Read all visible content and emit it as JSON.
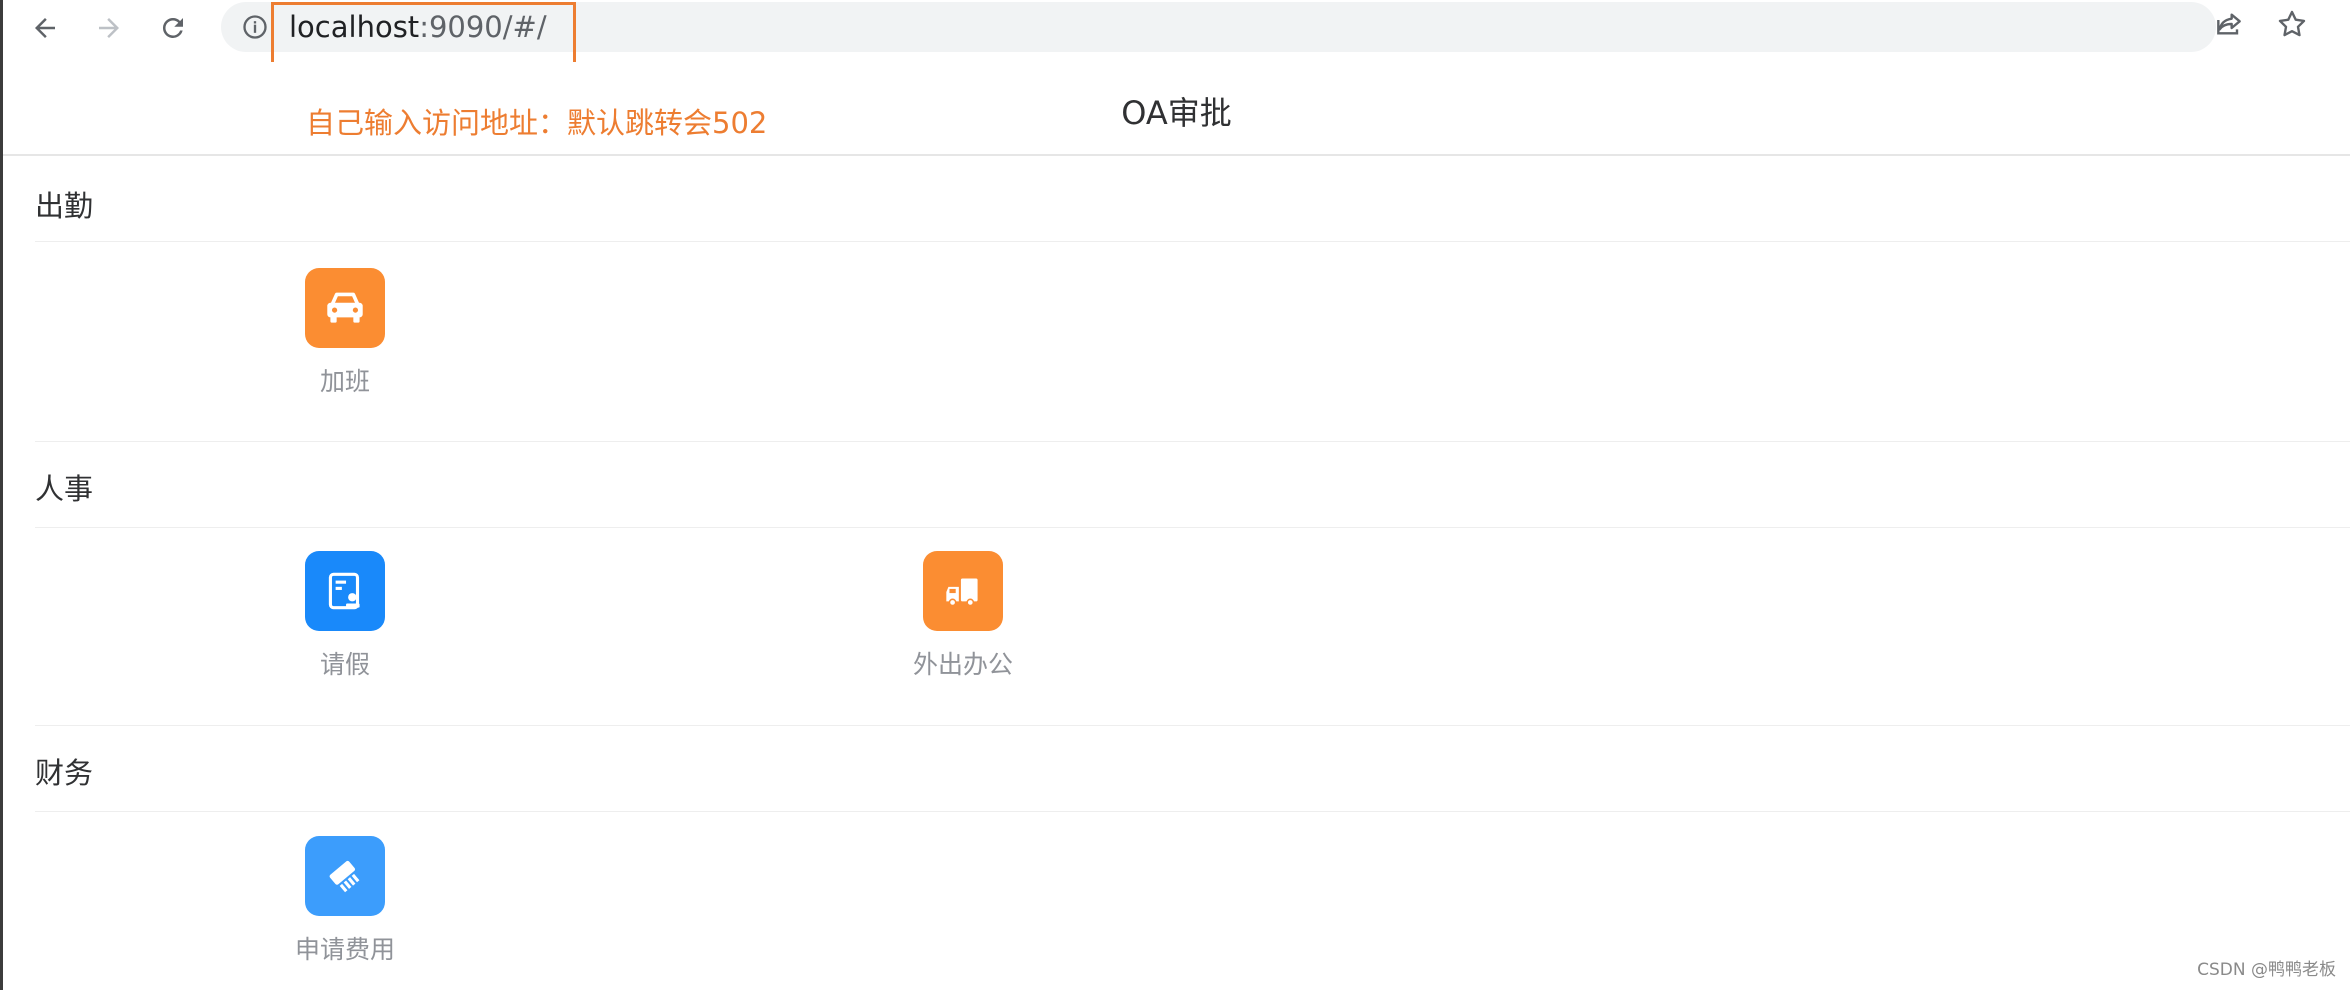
{
  "browser": {
    "url_host": "localhost",
    "url_path": ":9090/#/",
    "back_icon": "arrow-left-icon",
    "forward_icon": "arrow-right-icon",
    "reload_icon": "reload-icon",
    "info_icon": "info-icon",
    "share_icon": "share-icon",
    "bookmark_icon": "star-icon"
  },
  "header": {
    "title": "OA审批",
    "annotation": "自己输入访问地址：默认跳转会502"
  },
  "sections": [
    {
      "title": "出勤",
      "items": [
        {
          "label": "加班",
          "icon": "car-icon",
          "color": "#fb8d32"
        }
      ]
    },
    {
      "title": "人事",
      "items": [
        {
          "label": "请假",
          "icon": "leave-form-icon",
          "color": "#1989fa"
        },
        {
          "label": "外出办公",
          "icon": "truck-icon",
          "color": "#fb8d32"
        }
      ]
    },
    {
      "title": "财务",
      "items": [
        {
          "label": "申请费用",
          "icon": "expense-icon",
          "color": "#3c9dfc"
        }
      ]
    }
  ],
  "watermark": "CSDN @鸭鸭老板"
}
